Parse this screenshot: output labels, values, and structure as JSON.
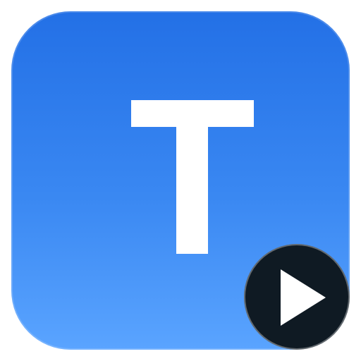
{
  "app_icon": {
    "letter": "T",
    "badge_icon": "play-icon",
    "colors": {
      "tile_top": "#2370e6",
      "tile_bottom": "#5aa4ff",
      "letter": "#ffffff",
      "badge_background": "#0f1a23",
      "badge_symbol": "#ffffff"
    }
  }
}
